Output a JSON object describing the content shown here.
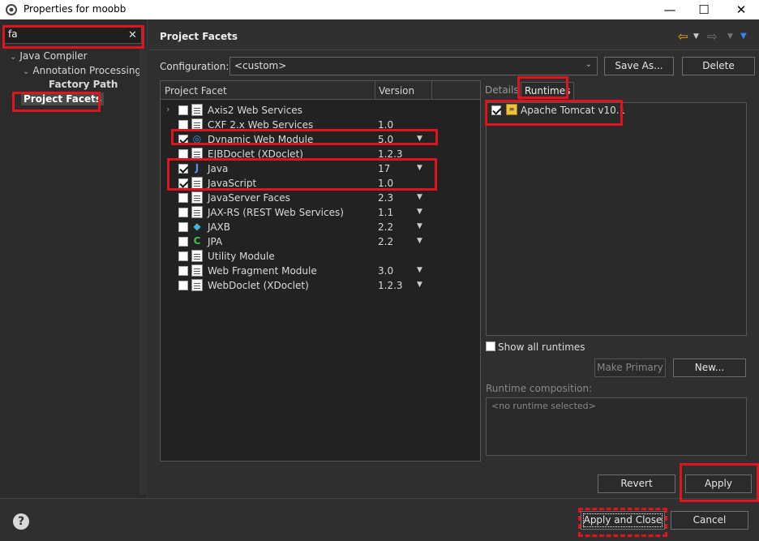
{
  "window": {
    "title": "Properties for moobb",
    "minimize": "—",
    "maximize": "☐",
    "close": "✕"
  },
  "filter": {
    "value": "fa",
    "clear": "✕"
  },
  "tree": [
    {
      "label": "Java Compiler",
      "expanded": true
    },
    {
      "label": "Annotation Processing",
      "expanded": true
    },
    {
      "label": "Factory Path"
    },
    {
      "label": "Project Facets",
      "selected": true
    }
  ],
  "page": {
    "title": "Project Facets",
    "configuration_label": "Configuration:",
    "configuration_value": "<custom>",
    "save_as": "Save As...",
    "delete": "Delete"
  },
  "facets": {
    "header": {
      "facet": "Project Facet",
      "version": "Version"
    },
    "rows": [
      {
        "name": "Axis2 Web Services",
        "version": "",
        "checked": false,
        "expandable": true,
        "icon": "folder-doc-icon"
      },
      {
        "name": "CXF 2.x Web Services",
        "version": "1.0",
        "checked": false,
        "icon": "document-icon"
      },
      {
        "name": "Dynamic Web Module",
        "version": "5.0",
        "checked": true,
        "dropdown": true,
        "icon": "web-module-icon"
      },
      {
        "name": "EJBDoclet (XDoclet)",
        "version": "1.2.3",
        "checked": false,
        "icon": "document-icon"
      },
      {
        "name": "Java",
        "version": "17",
        "checked": true,
        "dropdown": true,
        "icon": "java-icon"
      },
      {
        "name": "JavaScript",
        "version": "1.0",
        "checked": true,
        "icon": "document-icon"
      },
      {
        "name": "JavaServer Faces",
        "version": "2.3",
        "checked": false,
        "dropdown": true,
        "icon": "document-icon"
      },
      {
        "name": "JAX-RS (REST Web Services)",
        "version": "1.1",
        "checked": false,
        "dropdown": true,
        "icon": "document-icon"
      },
      {
        "name": "JAXB",
        "version": "2.2",
        "checked": false,
        "dropdown": true,
        "icon": "jaxb-icon"
      },
      {
        "name": "JPA",
        "version": "2.2",
        "checked": false,
        "dropdown": true,
        "icon": "jpa-icon"
      },
      {
        "name": "Utility Module",
        "version": "",
        "checked": false,
        "icon": "document-icon"
      },
      {
        "name": "Web Fragment Module",
        "version": "3.0",
        "checked": false,
        "dropdown": true,
        "icon": "document-icon"
      },
      {
        "name": "WebDoclet (XDoclet)",
        "version": "1.2.3",
        "checked": false,
        "dropdown": true,
        "icon": "document-icon"
      }
    ]
  },
  "runtimes": {
    "tab_details": "Details",
    "tab_runtimes": "Runtimes",
    "items": [
      {
        "name": "Apache Tomcat v10.1",
        "checked": true
      }
    ],
    "show_all": "Show all runtimes",
    "make_primary": "Make Primary",
    "new": "New...",
    "composition_label": "Runtime composition:",
    "composition_placeholder": "<no runtime selected>"
  },
  "actions": {
    "revert": "Revert",
    "apply": "Apply",
    "apply_and_close": "Apply and Close",
    "cancel": "Cancel",
    "help": "?"
  },
  "colors": {
    "highlight": "#e0141e",
    "nav_yellow": "#f4b400",
    "nav_blue": "#3b82f6"
  }
}
